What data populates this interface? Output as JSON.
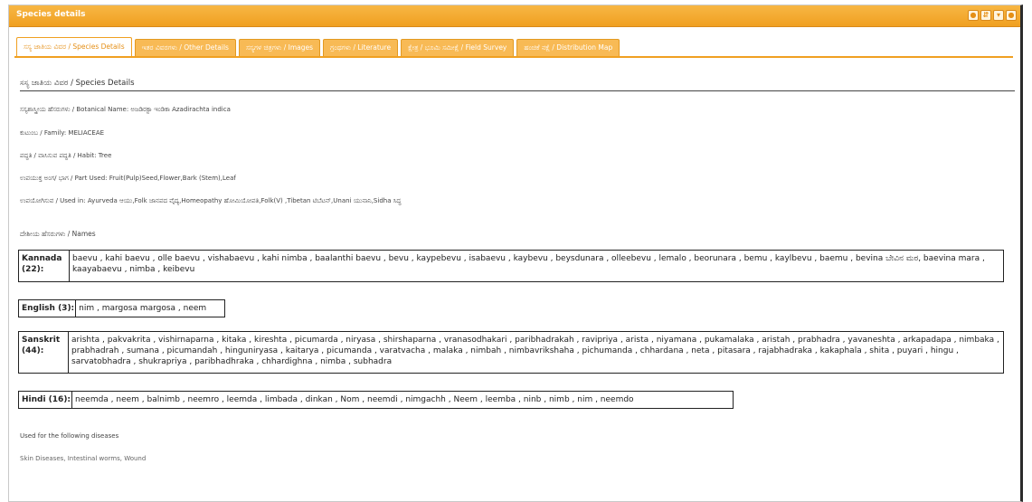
{
  "window": {
    "title": "Species details",
    "buttons": [
      "●",
      "⇵",
      "▾",
      "●"
    ]
  },
  "tabs": [
    {
      "label": "ಸಸ್ಯ ಜಾತಿಯ ವಿವರ / Species Details",
      "active": true
    },
    {
      "label": "ಇತರ ವಿವರಗಳು / Other Details",
      "active": false
    },
    {
      "label": "ಸಸ್ಯಗಳ ಚಿತ್ರಗಳು / Images",
      "active": false
    },
    {
      "label": "ಗ್ರಂಥಗಳು / Literature",
      "active": false
    },
    {
      "label": "ಕ್ಷೇತ್ರ / ಭೂಮಿ ಸಮೀಕ್ಷೆ / Field Survey",
      "active": false
    },
    {
      "label": "ಹಂಚಿಕೆ ನಕ್ಷೆ / Distribution Map",
      "active": false
    }
  ],
  "section_heading": "ಸಸ್ಯ ಜಾತಿಯ ವಿವರ / Species Details",
  "fields": {
    "botanical": "ಸಸ್ಯಶಾಸ್ತ್ರೀಯ ಹೆಸರುಗಳು / Botanical Name: ಅಜಡಿರಕ್ಟಾ ಇಂಡಿಕಾ Azadirachta indica",
    "family": "ಕುಟುಂಬ / Family: MELIACEAE",
    "habit": "ಪದ್ಧತಿ / ವಾಸಿಸುವ ಪದ್ಧತಿ / Habit: Tree",
    "part_used": "ಉಪಯುಕ್ತ ಅಂಗ/ ಭಾಗ / Part Used: Fruit(Pulp)Seed,Flower,Bark (Stem),Leaf",
    "used_in": "ಉಪಯೋಗಿಸುವ / Used in: Ayurveda ಆಯು,Folk ಜಾನಪದ ವೈದ್ಯ,Homeopathy ಹೋಮಿಯೋಪತಿ,Folk(V) ,Tibetan ಟಿಬೆಟನ್,Unani ಯುನಾನಿ,Sidha ಸಿದ್ಧ",
    "names_heading": "ದೇಶೀಯ ಹೆಸರುಗಳು / Names"
  },
  "names": {
    "kannada": {
      "lang": "Kannada (22):",
      "values": "baevu , kahi baevu , olle baevu , vishabaevu , kahi nimba , baalanthi baevu , bevu , kaypebevu , isabaevu , kaybevu , beysdunara , olleebevu , lemalo , beorunara , bemu , kaylbevu , baemu , bevina ಬೇವಿನ ಮರ, baevina mara , kaayabaevu , nimba , keibevu"
    },
    "english": {
      "lang": "English (3):",
      "values": "nim , margosa margosa , neem"
    },
    "sanskrit": {
      "lang": "Sanskrit (44):",
      "values": "arishta , pakvakrita , vishirnaparna , kitaka , kireshta , picumarda , niryasa , shirshaparna , vranasodhakari , paribhadrakah , ravipriya , arista , niyamana , pukamalaka , aristah , prabhadra , yavaneshta , arkapadapa , nimbaka , prabhadrah , sumana , picumandah , hinguniryasa , kaitarya , picumanda , varatvacha , malaka , nimbah , nimbavrikshaha , pichumanda , chhardana , neta , pitasara , rajabhadraka , kakaphala , shita , puyari , hingu , sarvatobhadra , shukrapriya , paribhadhraka , chhardighna , nimba , subhadra"
    },
    "hindi": {
      "lang": "Hindi (16):",
      "values": "neemda , neem , balnimb , neemro , leemda , limbada , dinkan , Nom , neemdi , nimgachh , Neem , leemba , ninb , nimb , nim , neemdo"
    }
  },
  "diseases": {
    "label": "Used for the following diseases",
    "value": "Skin Diseases, Intestinal worms, Wound"
  },
  "colors": {
    "accent": "#f0a021",
    "tab_inactive": "#f8ba55"
  }
}
